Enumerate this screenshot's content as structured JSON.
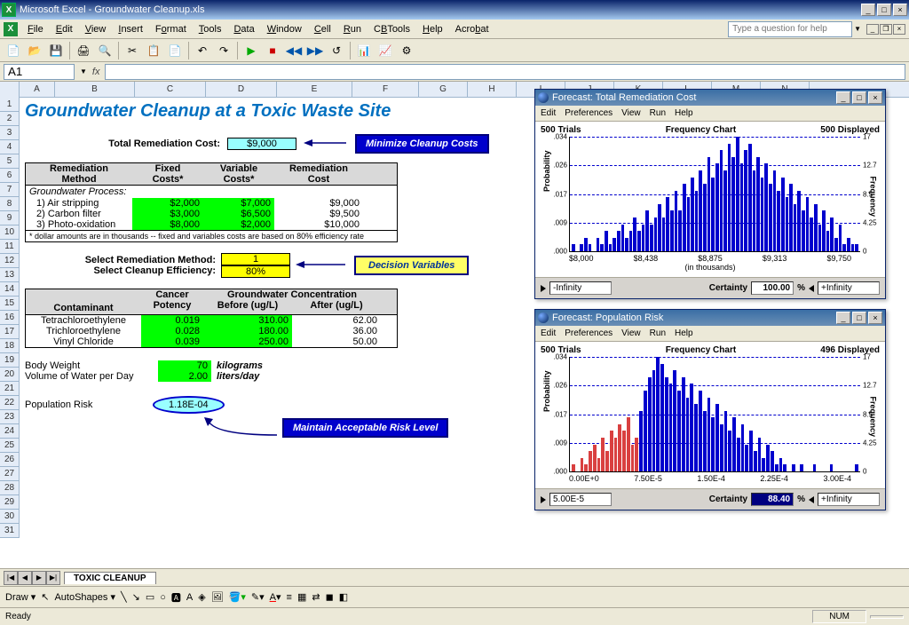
{
  "app": {
    "title": "Microsoft Excel - Groundwater Cleanup.xls"
  },
  "menu": [
    "File",
    "Edit",
    "View",
    "Insert",
    "Format",
    "Tools",
    "Data",
    "Window",
    "Cell",
    "Run",
    "CBTools",
    "Help",
    "Acrobat"
  ],
  "helpbox_placeholder": "Type a question for help",
  "namebox": "A1",
  "fx": "fx",
  "cols": [
    "A",
    "B",
    "C",
    "D",
    "E",
    "F",
    "G",
    "H",
    "I",
    "J",
    "K",
    "L",
    "M",
    "N"
  ],
  "rows": [
    "1",
    "2",
    "3",
    "4",
    "5",
    "6",
    "7",
    "8",
    "9",
    "10",
    "11",
    "12",
    "13",
    "14",
    "15",
    "16",
    "17",
    "18",
    "19",
    "20",
    "21",
    "22",
    "23",
    "24",
    "25",
    "26",
    "27",
    "28",
    "29",
    "30",
    "31"
  ],
  "doc": {
    "title": "Groundwater Cleanup at a Toxic Waste Site",
    "total_rem_label": "Total Remediation Cost:",
    "total_rem_value": "$9,000",
    "minimize_box": "Minimize Cleanup Costs",
    "tbl1": {
      "h1a": "Remediation",
      "h1b": "Method",
      "h2a": "Fixed",
      "h2b": "Costs*",
      "h3a": "Variable",
      "h3b": "Costs*",
      "h4a": "Remediation",
      "h4b": "Cost",
      "procrow": "Groundwater Process:",
      "r1": {
        "m": "1)  Air stripping",
        "f": "$2,000",
        "v": "$7,000",
        "c": "$9,000"
      },
      "r2": {
        "m": "2)  Carbon filter",
        "f": "$3,000",
        "v": "$6,500",
        "c": "$9,500"
      },
      "r3": {
        "m": "3)  Photo-oxidation",
        "f": "$8,000",
        "v": "$2,000",
        "c": "$10,000"
      },
      "foot": "* dollar amounts are in thousands -- fixed and variables costs are based on 80% efficiency rate"
    },
    "sel_method_label": "Select Remediation Method:",
    "sel_method_value": "1",
    "sel_eff_label": "Select Cleanup Efficiency:",
    "sel_eff_value": "80%",
    "decision_box": "Decision Variables",
    "tbl2": {
      "h1": "Contaminant",
      "h2a": "Cancer",
      "h2b": "Potency",
      "h3": "Groundwater Concentration",
      "h3a": "Before (ug/L)",
      "h3b": "After (ug/L)",
      "r1": {
        "c": "Tetrachloroethylene",
        "p": "0.019",
        "b": "310.00",
        "a": "62.00"
      },
      "r2": {
        "c": "Trichloroethylene",
        "p": "0.028",
        "b": "180.00",
        "a": "36.00"
      },
      "r3": {
        "c": "Vinyl Chloride",
        "p": "0.039",
        "b": "250.00",
        "a": "50.00"
      }
    },
    "bw_label": "Body Weight",
    "bw_val": "70",
    "bw_unit": "kilograms",
    "vol_label": "Volume of Water per Day",
    "vol_val": "2.00",
    "vol_unit": "liters/day",
    "pop_label": "Population Risk",
    "pop_val": "1.18E-04",
    "maintain_box": "Maintain Acceptable Risk Level"
  },
  "forecast1": {
    "title": "Forecast: Total Remediation Cost",
    "menu": [
      "Edit",
      "Preferences",
      "View",
      "Run",
      "Help"
    ],
    "trials": "500 Trials",
    "chartname": "Frequency Chart",
    "displayed": "500 Displayed",
    "ylabel": "Probability",
    "ylabel2": "Frequency",
    "yticks": [
      ".034",
      ".026",
      ".017",
      ".009",
      ".000"
    ],
    "yticks2": [
      "17",
      "12.7",
      "8.5",
      "4.25",
      "0"
    ],
    "xticks": [
      "$8,000",
      "$8,438",
      "$8,875",
      "$9,313",
      "$9,750"
    ],
    "xsub": "(in thousands)",
    "lo": "-Infinity",
    "cert_label": "Certainty",
    "cert": "100.00",
    "pct": "%",
    "hi": "+Infinity"
  },
  "forecast2": {
    "title": "Forecast: Population Risk",
    "menu": [
      "Edit",
      "Preferences",
      "View",
      "Run",
      "Help"
    ],
    "trials": "500 Trials",
    "chartname": "Frequency Chart",
    "displayed": "496 Displayed",
    "ylabel": "Probability",
    "ylabel2": "Frequency",
    "yticks": [
      ".034",
      ".026",
      ".017",
      ".009",
      ".000"
    ],
    "yticks2": [
      "17",
      "12.7",
      "8.5",
      "4.25",
      "0"
    ],
    "xticks": [
      "0.00E+0",
      "7.50E-5",
      "1.50E-4",
      "2.25E-4",
      "3.00E-4"
    ],
    "lo": "5.00E-5",
    "cert_label": "Certainty",
    "cert": "88.40",
    "pct": "%",
    "hi": "+Infinity"
  },
  "tabs": {
    "name": "TOXIC CLEANUP"
  },
  "draw": {
    "label": "Draw",
    "autoshapes": "AutoShapes"
  },
  "status": {
    "ready": "Ready",
    "num": "NUM"
  },
  "chart_data": [
    {
      "type": "bar",
      "title": "Forecast: Total Remediation Cost — Frequency Chart",
      "xlabel": "(in thousands)",
      "ylabel": "Probability",
      "y2label": "Frequency",
      "xlim": [
        8000,
        9750
      ],
      "ylim": [
        0,
        0.034
      ],
      "y2lim": [
        0,
        17
      ],
      "xticks": [
        8000,
        8438,
        8875,
        9313,
        9750
      ],
      "series": [
        {
          "name": "frequency",
          "color": "#0000cd",
          "values": [
            1,
            0,
            1,
            2,
            1,
            0,
            2,
            1,
            3,
            1,
            2,
            3,
            4,
            2,
            3,
            5,
            3,
            4,
            6,
            4,
            5,
            7,
            5,
            8,
            6,
            9,
            6,
            10,
            8,
            11,
            9,
            12,
            10,
            14,
            11,
            13,
            15,
            12,
            16,
            14,
            17,
            13,
            15,
            16,
            12,
            14,
            11,
            13,
            10,
            12,
            9,
            11,
            8,
            10,
            7,
            9,
            6,
            8,
            5,
            7,
            4,
            6,
            3,
            5,
            2,
            4,
            1,
            2,
            1,
            1
          ]
        }
      ]
    },
    {
      "type": "bar",
      "title": "Forecast: Population Risk — Frequency Chart",
      "xlabel": "",
      "ylabel": "Probability",
      "y2label": "Frequency",
      "xlim": [
        0,
        0.0003
      ],
      "ylim": [
        0,
        0.034
      ],
      "y2lim": [
        0,
        17
      ],
      "xticks": [
        0,
        7.5e-05,
        0.00015,
        0.000225,
        0.0003
      ],
      "threshold": 5e-05,
      "series": [
        {
          "name": "below-threshold",
          "color": "#d94040",
          "values": [
            1,
            0,
            2,
            1,
            3,
            4,
            2,
            5,
            3,
            6,
            5,
            7,
            6,
            8,
            4,
            5
          ]
        },
        {
          "name": "above-threshold",
          "color": "#0000cd",
          "values": [
            9,
            12,
            14,
            15,
            17,
            16,
            14,
            13,
            15,
            12,
            14,
            11,
            13,
            10,
            12,
            9,
            11,
            8,
            10,
            7,
            9,
            6,
            8,
            5,
            7,
            4,
            6,
            3,
            5,
            2,
            4,
            3,
            1,
            2,
            1,
            0,
            1,
            0,
            1,
            0,
            0,
            1,
            0,
            0,
            0,
            1,
            0,
            0,
            0,
            0,
            0,
            1
          ]
        }
      ]
    }
  ]
}
